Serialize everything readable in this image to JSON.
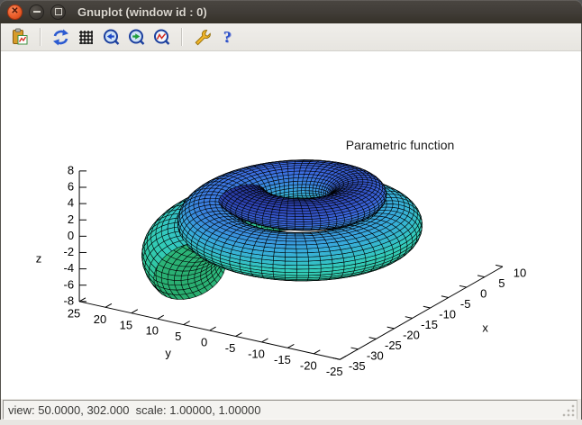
{
  "window": {
    "title": "Gnuplot (window id : 0)",
    "controls": [
      "close",
      "minimize",
      "maximize"
    ]
  },
  "toolbar": {
    "buttons": [
      {
        "name": "export-plot",
        "icon": "copy-clipboard-icon"
      },
      {
        "name": "replot",
        "icon": "refresh-icon"
      },
      {
        "name": "toggle-grid",
        "icon": "grid-icon"
      },
      {
        "name": "zoom-previous",
        "icon": "zoom-previous-icon"
      },
      {
        "name": "zoom-next",
        "icon": "zoom-next-icon"
      },
      {
        "name": "autoscale",
        "icon": "autoscale-icon"
      },
      {
        "name": "settings",
        "icon": "wrench-icon"
      },
      {
        "name": "help",
        "icon": "help-icon"
      }
    ]
  },
  "statusbar": {
    "text": "view: 50.0000, 302.000  scale: 1.00000, 1.00000"
  },
  "chart_data": {
    "type": "surface3d-parametric",
    "title": "Parametric function",
    "hidden3d": true,
    "mesh_color": "#000000",
    "background": "#ffffff",
    "axes": {
      "x": {
        "label": "x",
        "min": -35,
        "max": 10,
        "ticks": [
          -35,
          -30,
          -25,
          -20,
          -15,
          -10,
          -5,
          0,
          5,
          10
        ]
      },
      "y": {
        "label": "y",
        "min": -25,
        "max": 25,
        "ticks": [
          25,
          20,
          15,
          10,
          5,
          0,
          -5,
          -10,
          -15,
          -20,
          -25
        ]
      },
      "z": {
        "label": "z",
        "min": -8,
        "max": 8,
        "ticks": [
          -8,
          -6,
          -4,
          -2,
          0,
          2,
          4,
          6,
          8
        ]
      }
    },
    "view": {
      "rot_x": 50.0,
      "rot_z": 302.0,
      "scale": 1.0,
      "scale_z": 1.0
    },
    "palette": [
      [
        0.0,
        "#27a566"
      ],
      [
        0.22,
        "#2fc287"
      ],
      [
        0.45,
        "#33ccbc"
      ],
      [
        0.58,
        "#38a9dc"
      ],
      [
        0.7,
        "#3c6ae0"
      ],
      [
        0.8,
        "#2c41b0"
      ],
      [
        0.9,
        "#1b2370"
      ],
      [
        1.0,
        "#0e123a"
      ]
    ],
    "surface": {
      "description": "spiral shell, two nested turns",
      "u_min": 0,
      "u_max": 12.5664,
      "u_segments": 128,
      "v_min": 0,
      "v_max": 6.2832,
      "v_segments": 36,
      "center_x": -12.5,
      "start_angle_deg": 150,
      "direction": 1,
      "radius_start": 8.6,
      "radius_growth_per_rad": 0.72,
      "tube_h_start": 4.0,
      "tube_h_growth_per_rad": 0.18,
      "tube_v_start": 1.35,
      "tube_v_growth_per_rad": 0.16,
      "height_start": 4.0,
      "height_drop_per_rad": 0.62
    }
  }
}
